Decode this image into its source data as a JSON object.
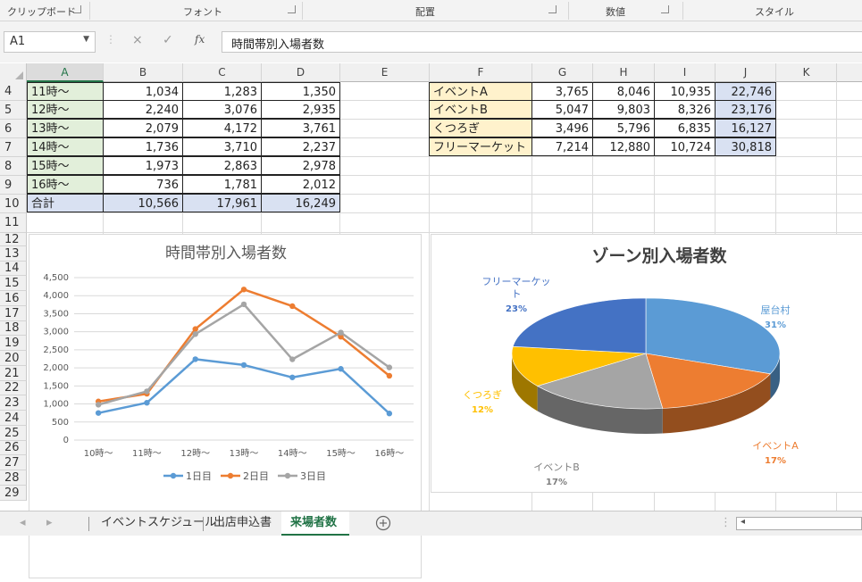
{
  "ribbon": {
    "groups": [
      "クリップボード",
      "フォント",
      "配置",
      "数値",
      "スタイル"
    ]
  },
  "formula_bar": {
    "name_box": "A1",
    "cancel_icon": "×",
    "enter_icon": "✓",
    "fx_icon": "fx",
    "formula": "時間帯別入場者数"
  },
  "columns": [
    "A",
    "B",
    "C",
    "D",
    "E",
    "F",
    "G",
    "H",
    "I",
    "J",
    "K"
  ],
  "rows": [
    "4",
    "5",
    "6",
    "7",
    "8",
    "9",
    "10",
    "11",
    "12",
    "13",
    "14",
    "15",
    "16",
    "17",
    "18",
    "19",
    "20",
    "21",
    "22",
    "23",
    "24",
    "25",
    "26",
    "27",
    "28",
    "29"
  ],
  "time_table": [
    {
      "label": "11時〜",
      "d1": "1,034",
      "d2": "1,283",
      "d3": "1,350"
    },
    {
      "label": "12時〜",
      "d1": "2,240",
      "d2": "3,076",
      "d3": "2,935"
    },
    {
      "label": "13時〜",
      "d1": "2,079",
      "d2": "4,172",
      "d3": "3,761"
    },
    {
      "label": "14時〜",
      "d1": "1,736",
      "d2": "3,710",
      "d3": "2,237"
    },
    {
      "label": "15時〜",
      "d1": "1,973",
      "d2": "2,863",
      "d3": "2,978"
    },
    {
      "label": "16時〜",
      "d1": "736",
      "d2": "1,781",
      "d3": "2,012"
    },
    {
      "label": "合計",
      "d1": "10,566",
      "d2": "17,961",
      "d3": "16,249"
    }
  ],
  "zone_table": [
    {
      "label": "イベントA",
      "g": "3,765",
      "h": "8,046",
      "i": "10,935",
      "j": "22,746"
    },
    {
      "label": "イベントB",
      "g": "5,047",
      "h": "9,803",
      "i": "8,326",
      "j": "23,176"
    },
    {
      "label": "くつろぎ",
      "g": "3,496",
      "h": "5,796",
      "i": "6,835",
      "j": "16,127"
    },
    {
      "label": "フリーマーケット",
      "g": "7,214",
      "h": "12,880",
      "i": "10,724",
      "j": "30,818"
    }
  ],
  "chart_data": [
    {
      "type": "line",
      "title": "時間帯別入場者数",
      "categories": [
        "10時〜",
        "11時〜",
        "12時〜",
        "13時〜",
        "14時〜",
        "15時〜",
        "16時〜"
      ],
      "ylim": [
        0,
        4500
      ],
      "yticks": [
        "0",
        "500",
        "1,000",
        "1,500",
        "2,000",
        "2,500",
        "3,000",
        "3,500",
        "4,000",
        "4,500"
      ],
      "grid": true,
      "legend": "bottom",
      "series": [
        {
          "name": "1日目",
          "color": "#5b9bd5",
          "values": [
            750,
            1034,
            2240,
            2079,
            1736,
            1973,
            736
          ]
        },
        {
          "name": "2日目",
          "color": "#ed7d31",
          "values": [
            1070,
            1283,
            3076,
            4172,
            3710,
            2863,
            1781
          ]
        },
        {
          "name": "3日目",
          "color": "#a5a5a5",
          "values": [
            980,
            1350,
            2935,
            3761,
            2237,
            2978,
            2012
          ]
        }
      ]
    },
    {
      "type": "pie",
      "title": "ゾーン別入場者数",
      "slices": [
        {
          "name": "屋台村",
          "percent": "31%",
          "value": 31,
          "color": "#5b9bd5"
        },
        {
          "name": "イベントA",
          "percent": "17%",
          "value": 17,
          "color": "#ed7d31"
        },
        {
          "name": "イベントB",
          "percent": "17%",
          "value": 17,
          "color": "#a5a5a5"
        },
        {
          "name": "くつろぎ",
          "percent": "12%",
          "value": 12,
          "color": "#ffc000"
        },
        {
          "name": "フリーマーケット",
          "percent": "23%",
          "value": 23,
          "color": "#4472c4"
        }
      ]
    }
  ],
  "sheet_tabs": {
    "prev": "◂",
    "next": "▸",
    "tabs": [
      "イベントスケジュール",
      "出店申込書",
      "来場者数"
    ],
    "active": "来場者数",
    "add": "+"
  }
}
